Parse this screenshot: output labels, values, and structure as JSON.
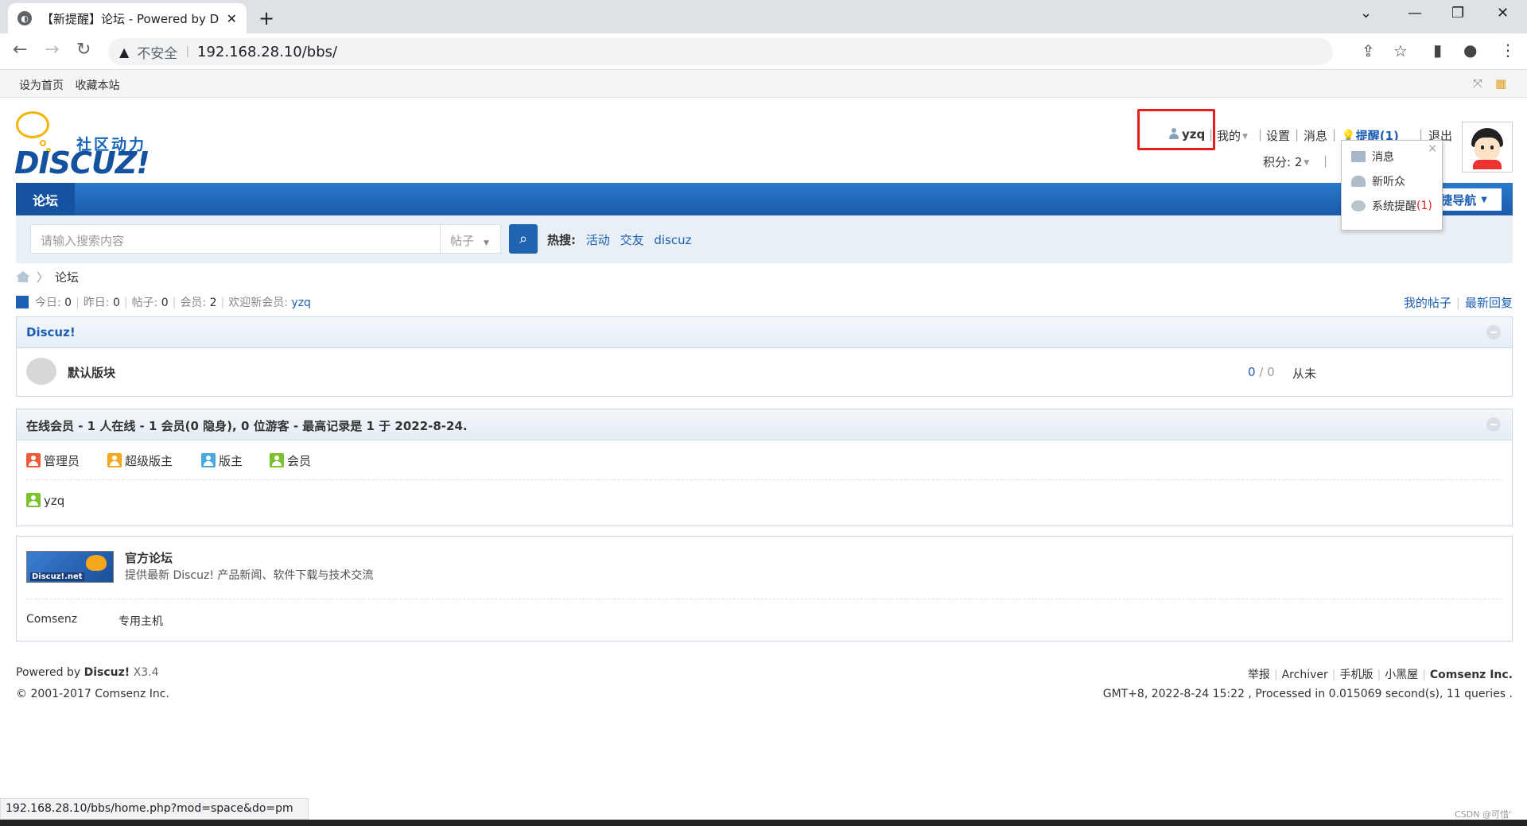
{
  "browser": {
    "tab_title": "【新提醒】论坛 - Powered by D",
    "insecure_label": "不安全",
    "url": "192.168.28.10/bbs/",
    "status_url": "192.168.28.10/bbs/home.php?mod=space&do=pm"
  },
  "topbar": {
    "set_home": "设为首页",
    "bookmark": "收藏本站"
  },
  "logo": {
    "sub": "社区动力",
    "main": "DISCUZ!"
  },
  "user": {
    "name": "yzq",
    "my": "我的",
    "settings": "设置",
    "messages": "消息",
    "remind": "提醒(1)",
    "logout": "退出",
    "credits": "积分: 2"
  },
  "remind_menu": {
    "items": [
      "消息",
      "新听众",
      "系统提醒"
    ],
    "sys_count": "(1)",
    "close": "×"
  },
  "nav": {
    "forum": "论坛",
    "quick": "快捷导航"
  },
  "search": {
    "placeholder": "请输入搜索内容",
    "type": "帖子",
    "hot_label": "热搜:",
    "hot_items": [
      "活动",
      "交友",
      "discuz"
    ]
  },
  "breadcrumb": {
    "current": "论坛"
  },
  "stats": {
    "today_label": "今日:",
    "today": "0",
    "yesterday_label": "昨日:",
    "yesterday": "0",
    "posts_label": "帖子:",
    "posts": "0",
    "members_label": "会员:",
    "members": "2",
    "welcome_label": "欢迎新会员:",
    "newest": "yzq",
    "my_posts": "我的帖子",
    "latest_replies": "最新回复"
  },
  "category": {
    "title": "Discuz!",
    "forum_name": "默认版块",
    "topics": "0",
    "posts": "0",
    "last_post": "从未"
  },
  "online": {
    "title": "在线会员 - 1 人在线 - 1 会员(0 隐身), 0 位游客 - 最高记录是 1 于 2022-8-24.",
    "legend": [
      "管理员",
      "超级版主",
      "版主",
      "会员"
    ],
    "members": [
      "yzq"
    ]
  },
  "links": {
    "logo_text": "Discuz!.net",
    "title": "官方论坛",
    "desc": "提供最新 Discuz! 产品新闻、软件下载与技术交流",
    "text_links": [
      "Comsenz",
      "专用主机"
    ]
  },
  "footer": {
    "powered_prefix": "Powered by",
    "powered_brand": "Discuz!",
    "version": "X3.4",
    "copyright": "© 2001-2017 Comsenz Inc.",
    "links": [
      "举报",
      "Archiver",
      "手机版",
      "小黑屋"
    ],
    "company": "Comsenz Inc.",
    "processed": "GMT+8, 2022-8-24 15:22 , Processed in 0.015069 second(s), 11 queries ."
  },
  "watermark": "CSDN @可惜'",
  "colors": {
    "accent": "#1d5fb5",
    "nav": "#2b7acd",
    "highlight": "#e81e1e"
  }
}
